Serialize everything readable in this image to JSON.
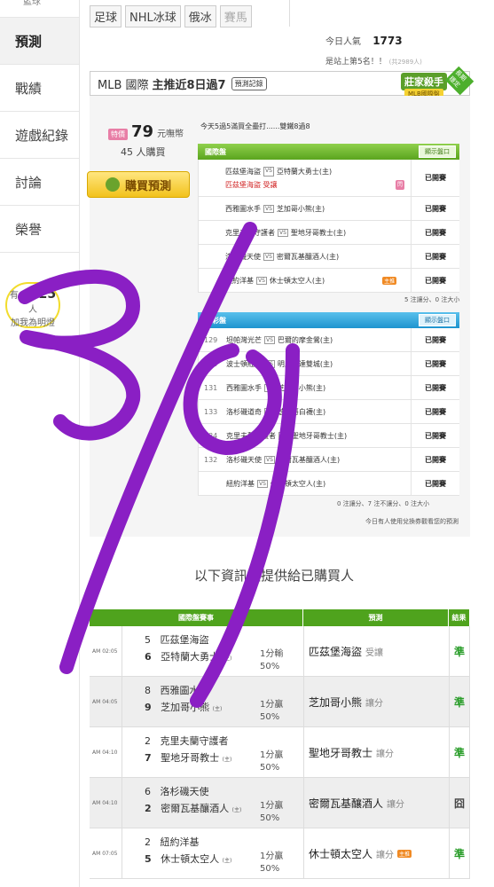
{
  "tabs": [
    "足球",
    "NHL冰球",
    "俄冰",
    "賽馬"
  ],
  "sidebar": {
    "top_label": "籃球",
    "items": [
      "預測",
      "戰績",
      "遊戲紀錄",
      "討論",
      "榮譽"
    ],
    "fans_prefix": "有",
    "fans_count": "4925",
    "fans_suffix": "人",
    "fans_label": "加我為明燈"
  },
  "popularity": {
    "label": "今日人氣",
    "value": "1773"
  },
  "rank": {
    "text": "是站上第5名！！",
    "note": "(共2989人)"
  },
  "header": {
    "league": "MLB 國際",
    "streak": "主推近8日過7",
    "history_btn": "預測記錄"
  },
  "badge": {
    "title": "莊家殺手",
    "sub": "MLB國際盤",
    "corner": "長期穩定"
  },
  "offer": {
    "tag": "特價",
    "price": "79",
    "unit": "元嘸幣",
    "buyers": "45 人購買",
    "buy_label": "購買預測",
    "intro": "今天5過5滿買全壘打......雙鐵8過8"
  },
  "intl_table": {
    "title": "國際盤",
    "show_label": "顯示盤口",
    "rows": [
      {
        "away": "匹茲堡海盜",
        "home": "亞特蘭大勇士(主)",
        "pick_line": "匹茲堡海盜 受讓",
        "status": "已開賽",
        "mark": "閃"
      },
      {
        "away": "西雅圖水手",
        "home": "芝加哥小熊(主)",
        "status": "已開賽"
      },
      {
        "away": "克里夫蘭守護者",
        "home": "聖地牙哥教士(主)",
        "status": "已開賽"
      },
      {
        "away": "洛杉磯天使",
        "home": "密爾瓦基釀酒人(主)",
        "status": "已開賽"
      },
      {
        "away": "紐約洋基",
        "home": "休士頓太空人(主)",
        "status": "已開賽",
        "mark": "主推"
      }
    ],
    "footer": "5 注讓分、0 注大小"
  },
  "lottery_table": {
    "title": "運彩盤",
    "show_label": "顯示盤口",
    "rows": [
      {
        "num": "129",
        "away": "坦帕灣光芒",
        "home": "巴爾的摩金鶯(主)",
        "status": "已開賽"
      },
      {
        "num": "125",
        "away": "波士頓紅襪",
        "home": "明尼蘇達雙城(主)",
        "status": "已開賽"
      },
      {
        "num": "131",
        "away": "西雅圖水手",
        "home": "芝加哥小熊(主)",
        "status": "已開賽"
      },
      {
        "num": "133",
        "away": "洛杉磯道奇",
        "home": "芝加哥白襪(主)",
        "status": "已開賽"
      },
      {
        "num": "134",
        "away": "克里夫蘭守護者",
        "home": "聖地牙哥教士(主)",
        "status": "已開賽"
      },
      {
        "num": "132",
        "away": "洛杉磯天使",
        "home": "密爾瓦基釀酒人(主)",
        "status": "已開賽"
      },
      {
        "num": "",
        "away": "紐約洋基",
        "home": "休士頓太空人(主)",
        "status": "已開賽"
      }
    ],
    "footer": "0 注讓分、7 注不讓分、0 注大小",
    "note": "今日有人使用兌換券觀看您的預測"
  },
  "notice": "以下資訊僅提供給已購買人",
  "results": {
    "headers": [
      "國際盤賽事",
      "預測",
      "結果"
    ],
    "rows": [
      {
        "time": "AM 02:05",
        "n1": "5",
        "team1": "匹茲堡海盜",
        "n2": "6",
        "team2": "亞特蘭大勇士",
        "home_tag": "(主)",
        "line": "1分輸",
        "pct": "50%",
        "pick": "匹茲堡海盜",
        "hint": "受讓",
        "result": "準"
      },
      {
        "time": "AM 04:05",
        "n1": "8",
        "team1": "西雅圖水手",
        "n2": "9",
        "team2": "芝加哥小熊",
        "home_tag": "(主)",
        "line": "1分贏",
        "pct": "50%",
        "pick": "芝加哥小熊",
        "hint": "讓分",
        "result": "準"
      },
      {
        "time": "AM 04:10",
        "n1": "2",
        "team1": "克里夫蘭守護者",
        "n2": "7",
        "team2": "聖地牙哥教士",
        "home_tag": "(主)",
        "line": "1分贏",
        "pct": "50%",
        "pick": "聖地牙哥教士",
        "hint": "讓分",
        "result": "準"
      },
      {
        "time": "AM 04:10",
        "n1": "6",
        "team1": "洛杉磯天使",
        "n2": "2",
        "team2": "密爾瓦基釀酒人",
        "home_tag": "(主)",
        "line": "1分贏",
        "pct": "50%",
        "pick": "密爾瓦基釀酒人",
        "hint": "讓分",
        "result": "囧"
      },
      {
        "time": "AM 07:05",
        "n1": "2",
        "team1": "紐約洋基",
        "n2": "5",
        "team2": "休士頓太空人",
        "home_tag": "(主)",
        "line": "1分贏",
        "pct": "50%",
        "pick": "休士頓太空人",
        "hint": "讓分",
        "mark": "主推",
        "result": "準"
      }
    ]
  },
  "colors": {
    "green": "#5aa41e",
    "blue": "#1e94cf",
    "scribble": "#8a1fc4",
    "gold": "#f2c21c"
  }
}
